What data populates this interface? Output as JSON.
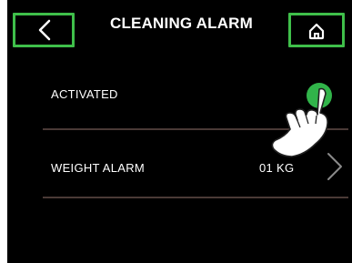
{
  "header": {
    "title": "CLEANING ALARM",
    "back_icon": "chevron-left-icon",
    "home_icon": "home-icon",
    "accent_color": "#3fbf4a"
  },
  "settings": {
    "rows": [
      {
        "label": "ACTIVATED",
        "control": "toggle",
        "state": "on",
        "toggle_color": "#31b44a"
      },
      {
        "label": "WEIGHT ALARM",
        "value": "01 KG",
        "control_icon": "chevron-right-icon"
      }
    ]
  },
  "overlay": {
    "icon": "tap-hand-icon"
  },
  "colors": {
    "background": "#000000",
    "text": "#ffffff",
    "divider": "#4a3a36"
  }
}
